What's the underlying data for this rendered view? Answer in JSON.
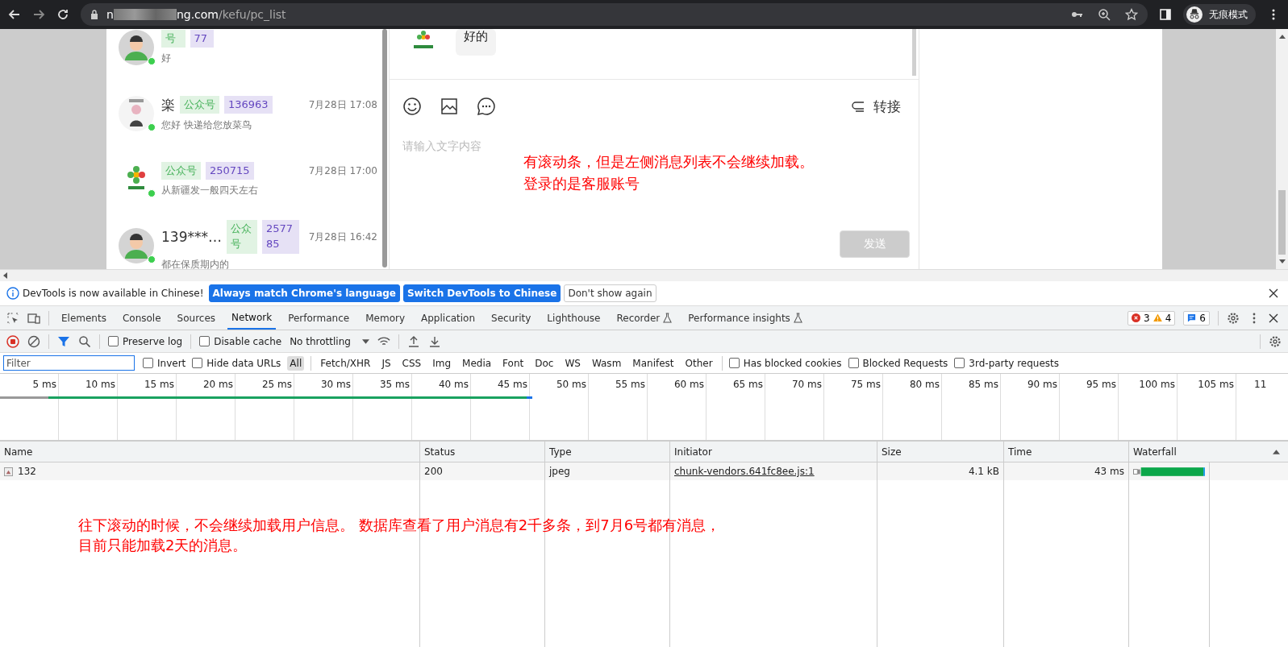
{
  "browser": {
    "url_start": "n",
    "url_host_end": "ng.com",
    "url_path": "/kefu/pc_list",
    "profile_label": "无痕模式"
  },
  "conversations": [
    {
      "tags": [
        {
          "text": "号",
          "kind": "channel"
        },
        {
          "text": "77",
          "kind": "id"
        }
      ],
      "message": "好",
      "kind": "person",
      "online": true
    },
    {
      "name": "楽",
      "tags": [
        {
          "text": "公众号",
          "kind": "channel"
        },
        {
          "text": "136963",
          "kind": "id"
        }
      ],
      "time": "7月28日 17:08",
      "message": "您好 快递给您放菜鸟",
      "kind": "cartoon",
      "online": true
    },
    {
      "tags": [
        {
          "text": "公众号",
          "kind": "channel"
        },
        {
          "text": "250715",
          "kind": "id"
        }
      ],
      "time": "7月28日 17:00",
      "message": "从新疆发一般四天左右",
      "kind": "logo",
      "online": true
    },
    {
      "name": "139***…",
      "tags": [
        {
          "text": "公众号",
          "kind": "channel"
        },
        {
          "text": "257785",
          "kind": "id"
        }
      ],
      "time": "7月28日 16:42",
      "message": "都在保质期内的",
      "kind": "person",
      "online": true
    }
  ],
  "chat": {
    "last_message": "好的",
    "transfer_label": "转接",
    "input": {
      "placeholder": "请输入文字内容"
    },
    "send_button": {
      "label": "发送",
      "disabled": true
    },
    "annotation": [
      "有滚动条，但是左侧消息列表不会继续加载。",
      "登录的是客服账号"
    ]
  },
  "devtools": {
    "infobar": {
      "message": "DevTools is now available in Chinese!",
      "buttons": [
        {
          "label": "Always match Chrome's language",
          "kind": "primary"
        },
        {
          "label": "Switch DevTools to Chinese",
          "kind": "primary"
        },
        {
          "label": "Don't show again",
          "kind": "secondary"
        }
      ]
    },
    "tabs": [
      {
        "label": "Elements",
        "selected": false,
        "experimental": false
      },
      {
        "label": "Console",
        "selected": false,
        "experimental": false
      },
      {
        "label": "Sources",
        "selected": false,
        "experimental": false
      },
      {
        "label": "Network",
        "selected": true,
        "experimental": false
      },
      {
        "label": "Performance",
        "selected": false,
        "experimental": false
      },
      {
        "label": "Memory",
        "selected": false,
        "experimental": false
      },
      {
        "label": "Application",
        "selected": false,
        "experimental": false
      },
      {
        "label": "Security",
        "selected": false,
        "experimental": false
      },
      {
        "label": "Lighthouse",
        "selected": false,
        "experimental": false
      },
      {
        "label": "Recorder",
        "selected": false,
        "experimental": true
      },
      {
        "label": "Performance insights",
        "selected": false,
        "experimental": true
      }
    ],
    "counts": {
      "errors": "3",
      "warnings": "4",
      "messages": "6"
    },
    "toolbar": {
      "preserve_log": {
        "label": "Preserve log",
        "checked": false
      },
      "disable_cache": {
        "label": "Disable cache",
        "checked": false
      },
      "throttling": "No throttling"
    },
    "filter": {
      "placeholder": "Filter",
      "invert": {
        "label": "Invert",
        "checked": false
      },
      "hide_data_urls": {
        "label": "Hide data URLs",
        "checked": false
      },
      "types": [
        {
          "label": "All",
          "selected": true
        },
        {
          "label": "Fetch/XHR",
          "selected": false
        },
        {
          "label": "JS",
          "selected": false
        },
        {
          "label": "CSS",
          "selected": false
        },
        {
          "label": "Img",
          "selected": false
        },
        {
          "label": "Media",
          "selected": false
        },
        {
          "label": "Font",
          "selected": false
        },
        {
          "label": "Doc",
          "selected": false
        },
        {
          "label": "WS",
          "selected": false
        },
        {
          "label": "Wasm",
          "selected": false
        },
        {
          "label": "Manifest",
          "selected": false
        },
        {
          "label": "Other",
          "selected": false
        }
      ],
      "options": [
        {
          "label": "Has blocked cookies",
          "checked": false
        },
        {
          "label": "Blocked Requests",
          "checked": false
        },
        {
          "label": "3rd-party requests",
          "checked": false
        }
      ]
    },
    "timeline_ticks": [
      "5 ms",
      "10 ms",
      "15 ms",
      "20 ms",
      "25 ms",
      "30 ms",
      "35 ms",
      "40 ms",
      "45 ms",
      "50 ms",
      "55 ms",
      "60 ms",
      "65 ms",
      "70 ms",
      "75 ms",
      "80 ms",
      "85 ms",
      "90 ms",
      "95 ms",
      "100 ms",
      "105 ms",
      "11"
    ],
    "table": {
      "columns": [
        "Name",
        "Status",
        "Type",
        "Initiator",
        "Size",
        "Time",
        "Waterfall"
      ],
      "rows": [
        {
          "name": "132",
          "status": "200",
          "type": "jpeg",
          "initiator": "chunk-vendors.641fc8ee.js:1",
          "size": "4.1 kB",
          "time": "43 ms"
        }
      ]
    },
    "annotation": [
      "往下滚动的时候，不会继续加载用户信息。 数据库查看了用户消息有2千多条，到7月6号都有消息，",
      "目前只能加载2天的消息。"
    ]
  }
}
